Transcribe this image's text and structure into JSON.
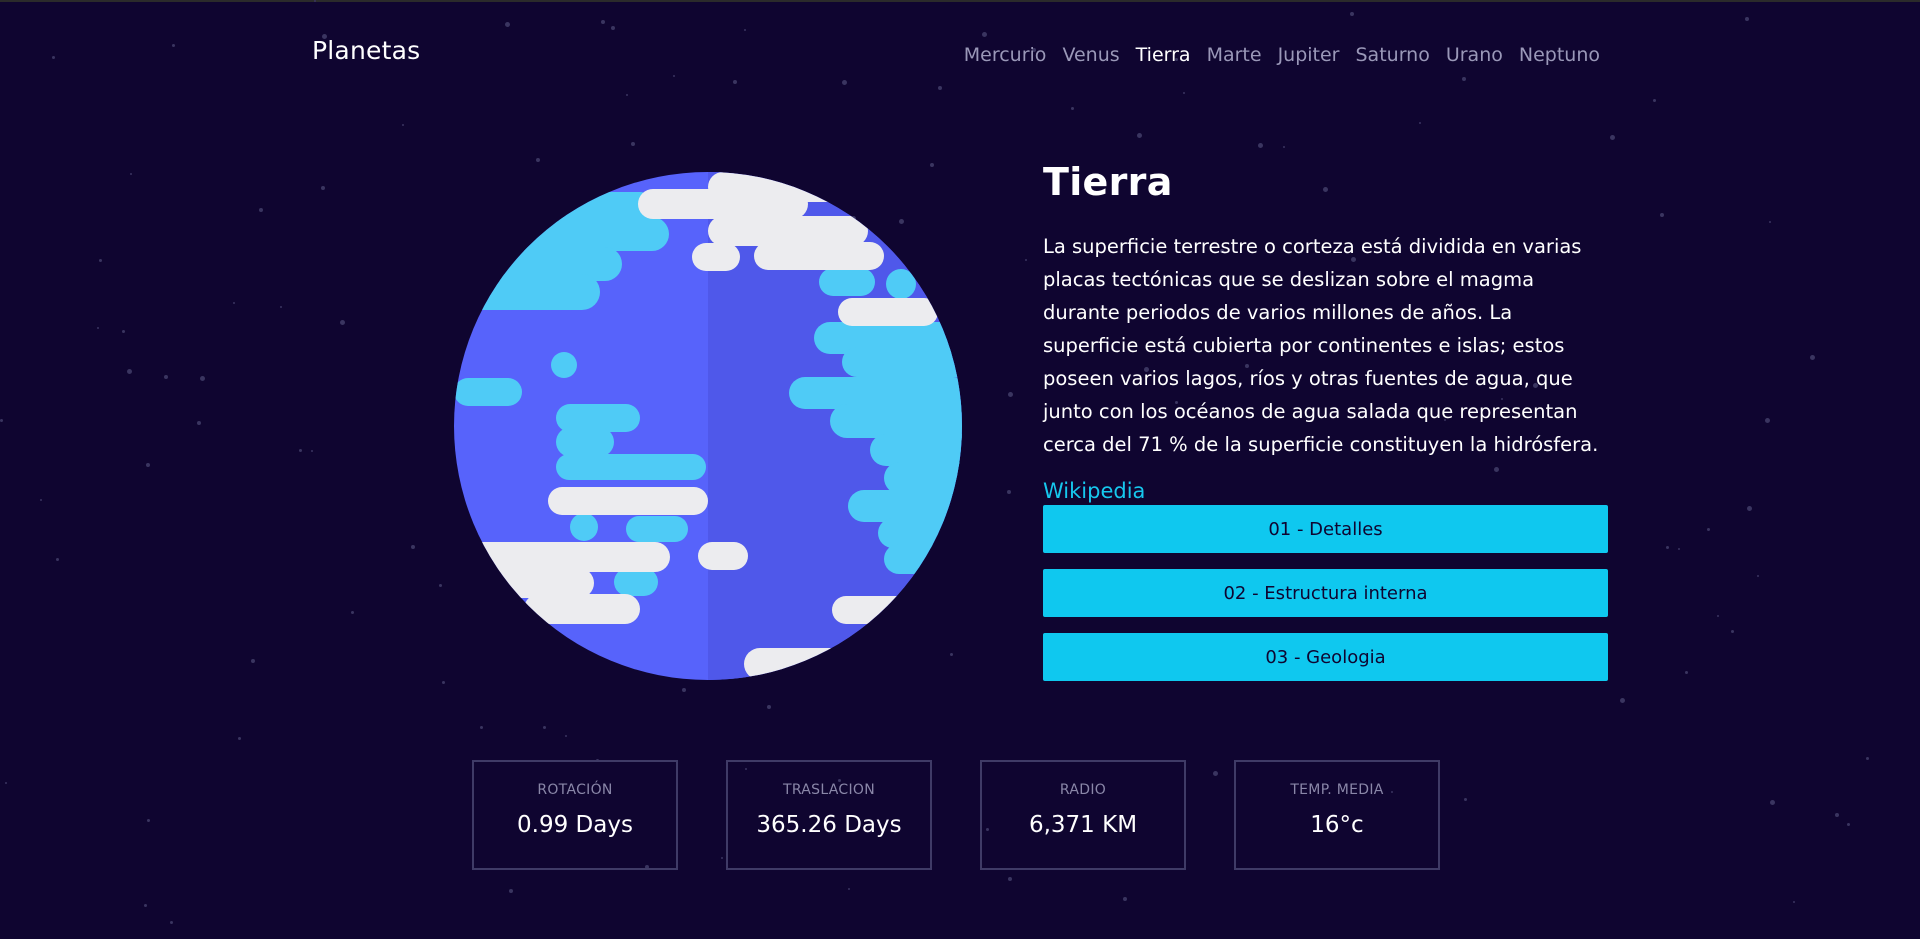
{
  "header": {
    "brand": "Planetas",
    "nav": [
      {
        "label": "Mercurio",
        "active": false
      },
      {
        "label": "Venus",
        "active": false
      },
      {
        "label": "Tierra",
        "active": true
      },
      {
        "label": "Marte",
        "active": false
      },
      {
        "label": "Jupiter",
        "active": false
      },
      {
        "label": "Saturno",
        "active": false
      },
      {
        "label": "Urano",
        "active": false
      },
      {
        "label": "Neptuno",
        "active": false
      }
    ]
  },
  "planet": {
    "title": "Tierra",
    "description": "La superficie terrestre o corteza está dividida en varias placas tectónicas que se deslizan sobre el magma durante periodos de varios millones de años. La superficie está cubierta por continentes e islas; estos poseen varios lagos, ríos y otras fuentes de agua, que junto con los océanos de agua salada que representan cerca del 71 % de la superficie constituyen la hidrósfera.",
    "link_label": "Wikipedia",
    "buttons": [
      "01 - Detalles",
      "02 - Estructura interna",
      "03 - Geologia"
    ]
  },
  "stats": [
    {
      "label": "ROTACIÓN",
      "value": "0.99 Days"
    },
    {
      "label": "TRASLACION",
      "value": "365.26 Days"
    },
    {
      "label": "RADIO",
      "value": "6,371 KM"
    },
    {
      "label": "TEMP. MEDIA",
      "value": "16°c"
    }
  ],
  "colors": {
    "background": "#0f0530",
    "accent": "#0fc8ef",
    "ocean": "#5763fb",
    "land": "#4fcbf6",
    "cloud": "#ececef"
  }
}
